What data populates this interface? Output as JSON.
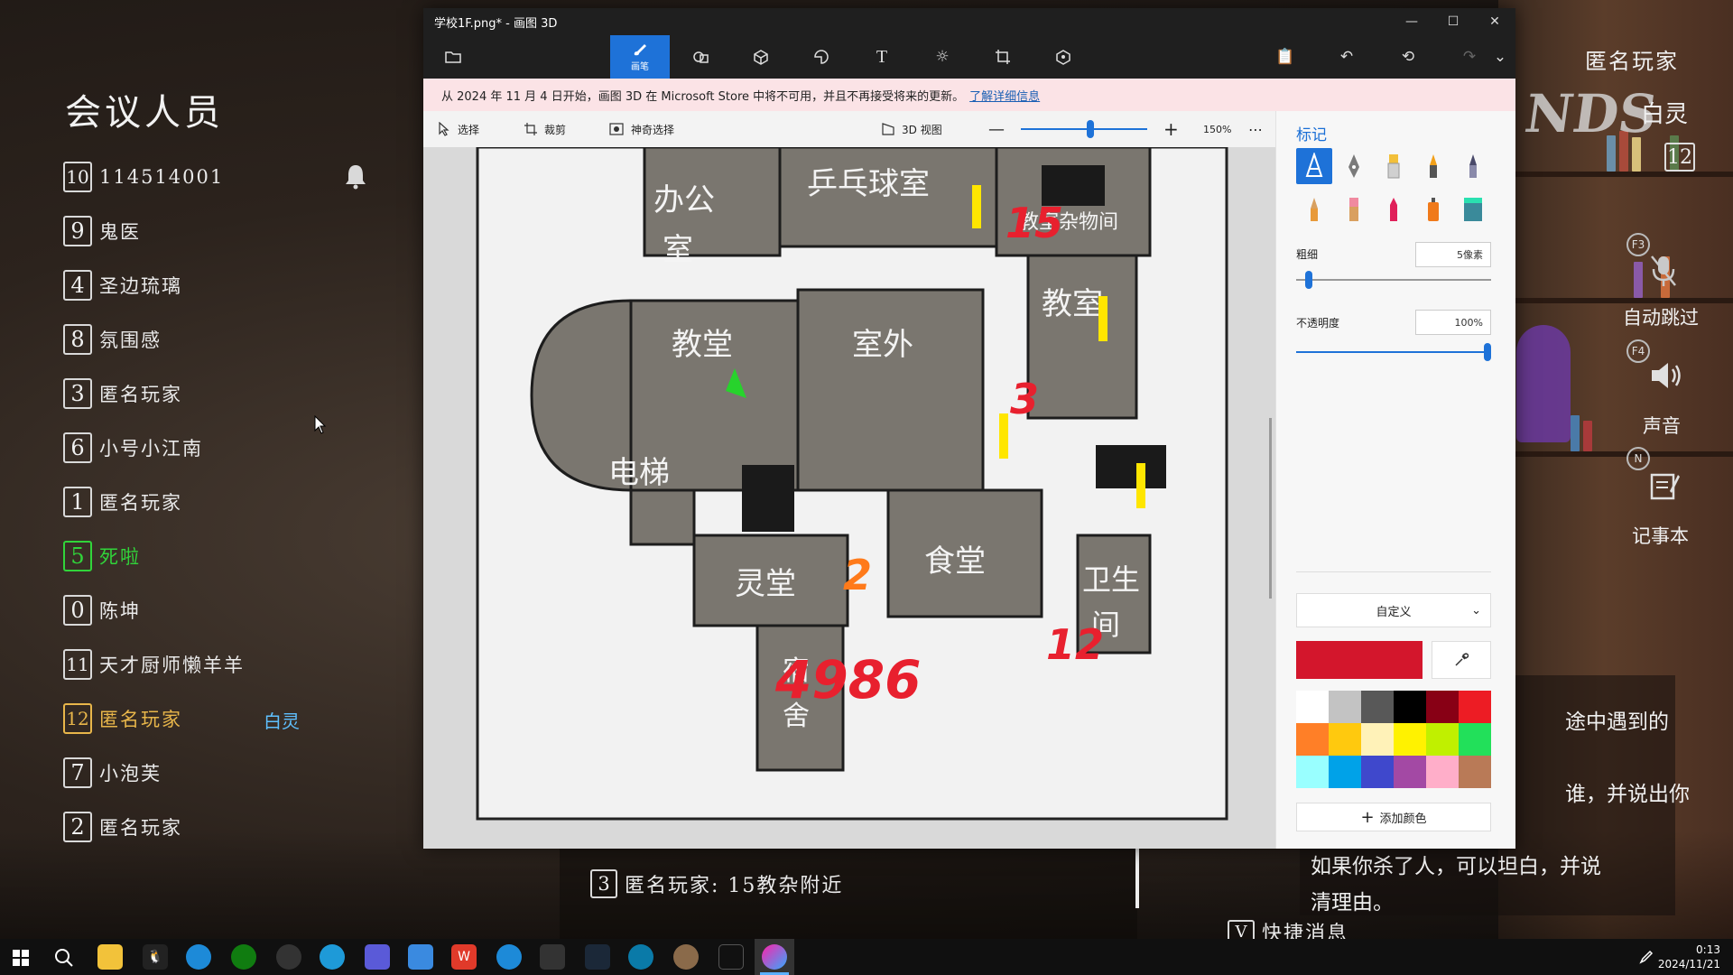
{
  "game": {
    "meeting_title": "会议人员",
    "members": [
      {
        "num": "10",
        "name": "114514001",
        "style": "normal"
      },
      {
        "num": "9",
        "name": "鬼医",
        "style": "normal"
      },
      {
        "num": "4",
        "name": "圣边琉璃",
        "style": "normal"
      },
      {
        "num": "8",
        "name": "氛围感",
        "style": "normal"
      },
      {
        "num": "3",
        "name": "匿名玩家",
        "style": "normal"
      },
      {
        "num": "6",
        "name": "小号小江南",
        "style": "normal"
      },
      {
        "num": "1",
        "name": "匿名玩家",
        "style": "normal"
      },
      {
        "num": "5",
        "name": "死啦",
        "style": "dead"
      },
      {
        "num": "0",
        "name": "陈坤",
        "style": "normal"
      },
      {
        "num": "11",
        "name": "天才厨师懒羊羊",
        "style": "normal"
      },
      {
        "num": "12",
        "name": "匿名玩家",
        "style": "gold",
        "role": "白灵"
      },
      {
        "num": "7",
        "name": "小泡芙",
        "style": "normal"
      },
      {
        "num": "2",
        "name": "匿名玩家",
        "style": "normal"
      }
    ],
    "right_hud": {
      "player_name": "匿名玩家",
      "role": "白灵",
      "player_num": "12",
      "key_f3": "F3",
      "auto_skip": "自动跳过",
      "key_f4": "F4",
      "sound": "声音",
      "key_n": "N",
      "notepad": "记事本",
      "logo_text": "NDS"
    },
    "chat": {
      "line_num": "3",
      "line_text": "匿名玩家: 15教杂附近",
      "tip_1": "途中遇到的",
      "tip_2": "谁，并说出你",
      "tip_3": "如果你杀了人，可以坦白，并说",
      "tip_4": "清理由。",
      "quick_num": "V",
      "quick_text": "快捷消息"
    }
  },
  "paint3d": {
    "window_title": "学校1F.png* - 画图 3D",
    "tools": [
      {
        "icon": "folder-icon",
        "label": ""
      },
      {
        "icon": "brush-icon",
        "label": "画笔"
      },
      {
        "icon": "shapes-2d-icon",
        "label": ""
      },
      {
        "icon": "cube-3d-icon",
        "label": ""
      },
      {
        "icon": "sticker-icon",
        "label": ""
      },
      {
        "icon": "text-icon",
        "label": ""
      },
      {
        "icon": "effects-icon",
        "label": ""
      },
      {
        "icon": "canvas-icon",
        "label": ""
      },
      {
        "icon": "library-3d-icon",
        "label": ""
      }
    ],
    "banner_text": "从 2024 年 11 月 4 日开始，画图 3D 在 Microsoft Store 中将不可用，并且不再接受将来的更新。",
    "banner_link": "了解详细信息",
    "subbar": {
      "select": "选择",
      "crop": "裁剪",
      "magic_select": "神奇选择",
      "view_3d": "3D 视图",
      "zoom": "150%",
      "zoom_fraction": 0.55
    },
    "panel": {
      "title": "标记",
      "thickness_label": "粗细",
      "thickness_value": "5像素",
      "thickness_fraction": 0.05,
      "opacity_label": "不透明度",
      "opacity_value": "100%",
      "opacity_fraction": 1.0,
      "color_mode": "自定义",
      "add_color": "添加颜色",
      "current_color": "#d3162c",
      "palette": [
        "#ffffff",
        "#c3c3c3",
        "#585858",
        "#000000",
        "#880015",
        "#ed1c24",
        "#ff7f27",
        "#ffc90e",
        "#fff2b8",
        "#fff200",
        "#c0f000",
        "#22e05a",
        "#99ffff",
        "#00a2e8",
        "#3f48cc",
        "#a349a4",
        "#ffaec9",
        "#b97a57"
      ]
    },
    "map": {
      "rooms": [
        "办公室",
        "乒乓球室",
        "教室杂物间",
        "教堂",
        "室外",
        "教室",
        "电梯",
        "灵堂",
        "食堂",
        "卫生间",
        "宿舍"
      ],
      "annotations": [
        "15",
        "3",
        "2",
        "12",
        "4986"
      ]
    }
  },
  "taskbar": {
    "time": "0:13",
    "date": "2024/11/21"
  }
}
